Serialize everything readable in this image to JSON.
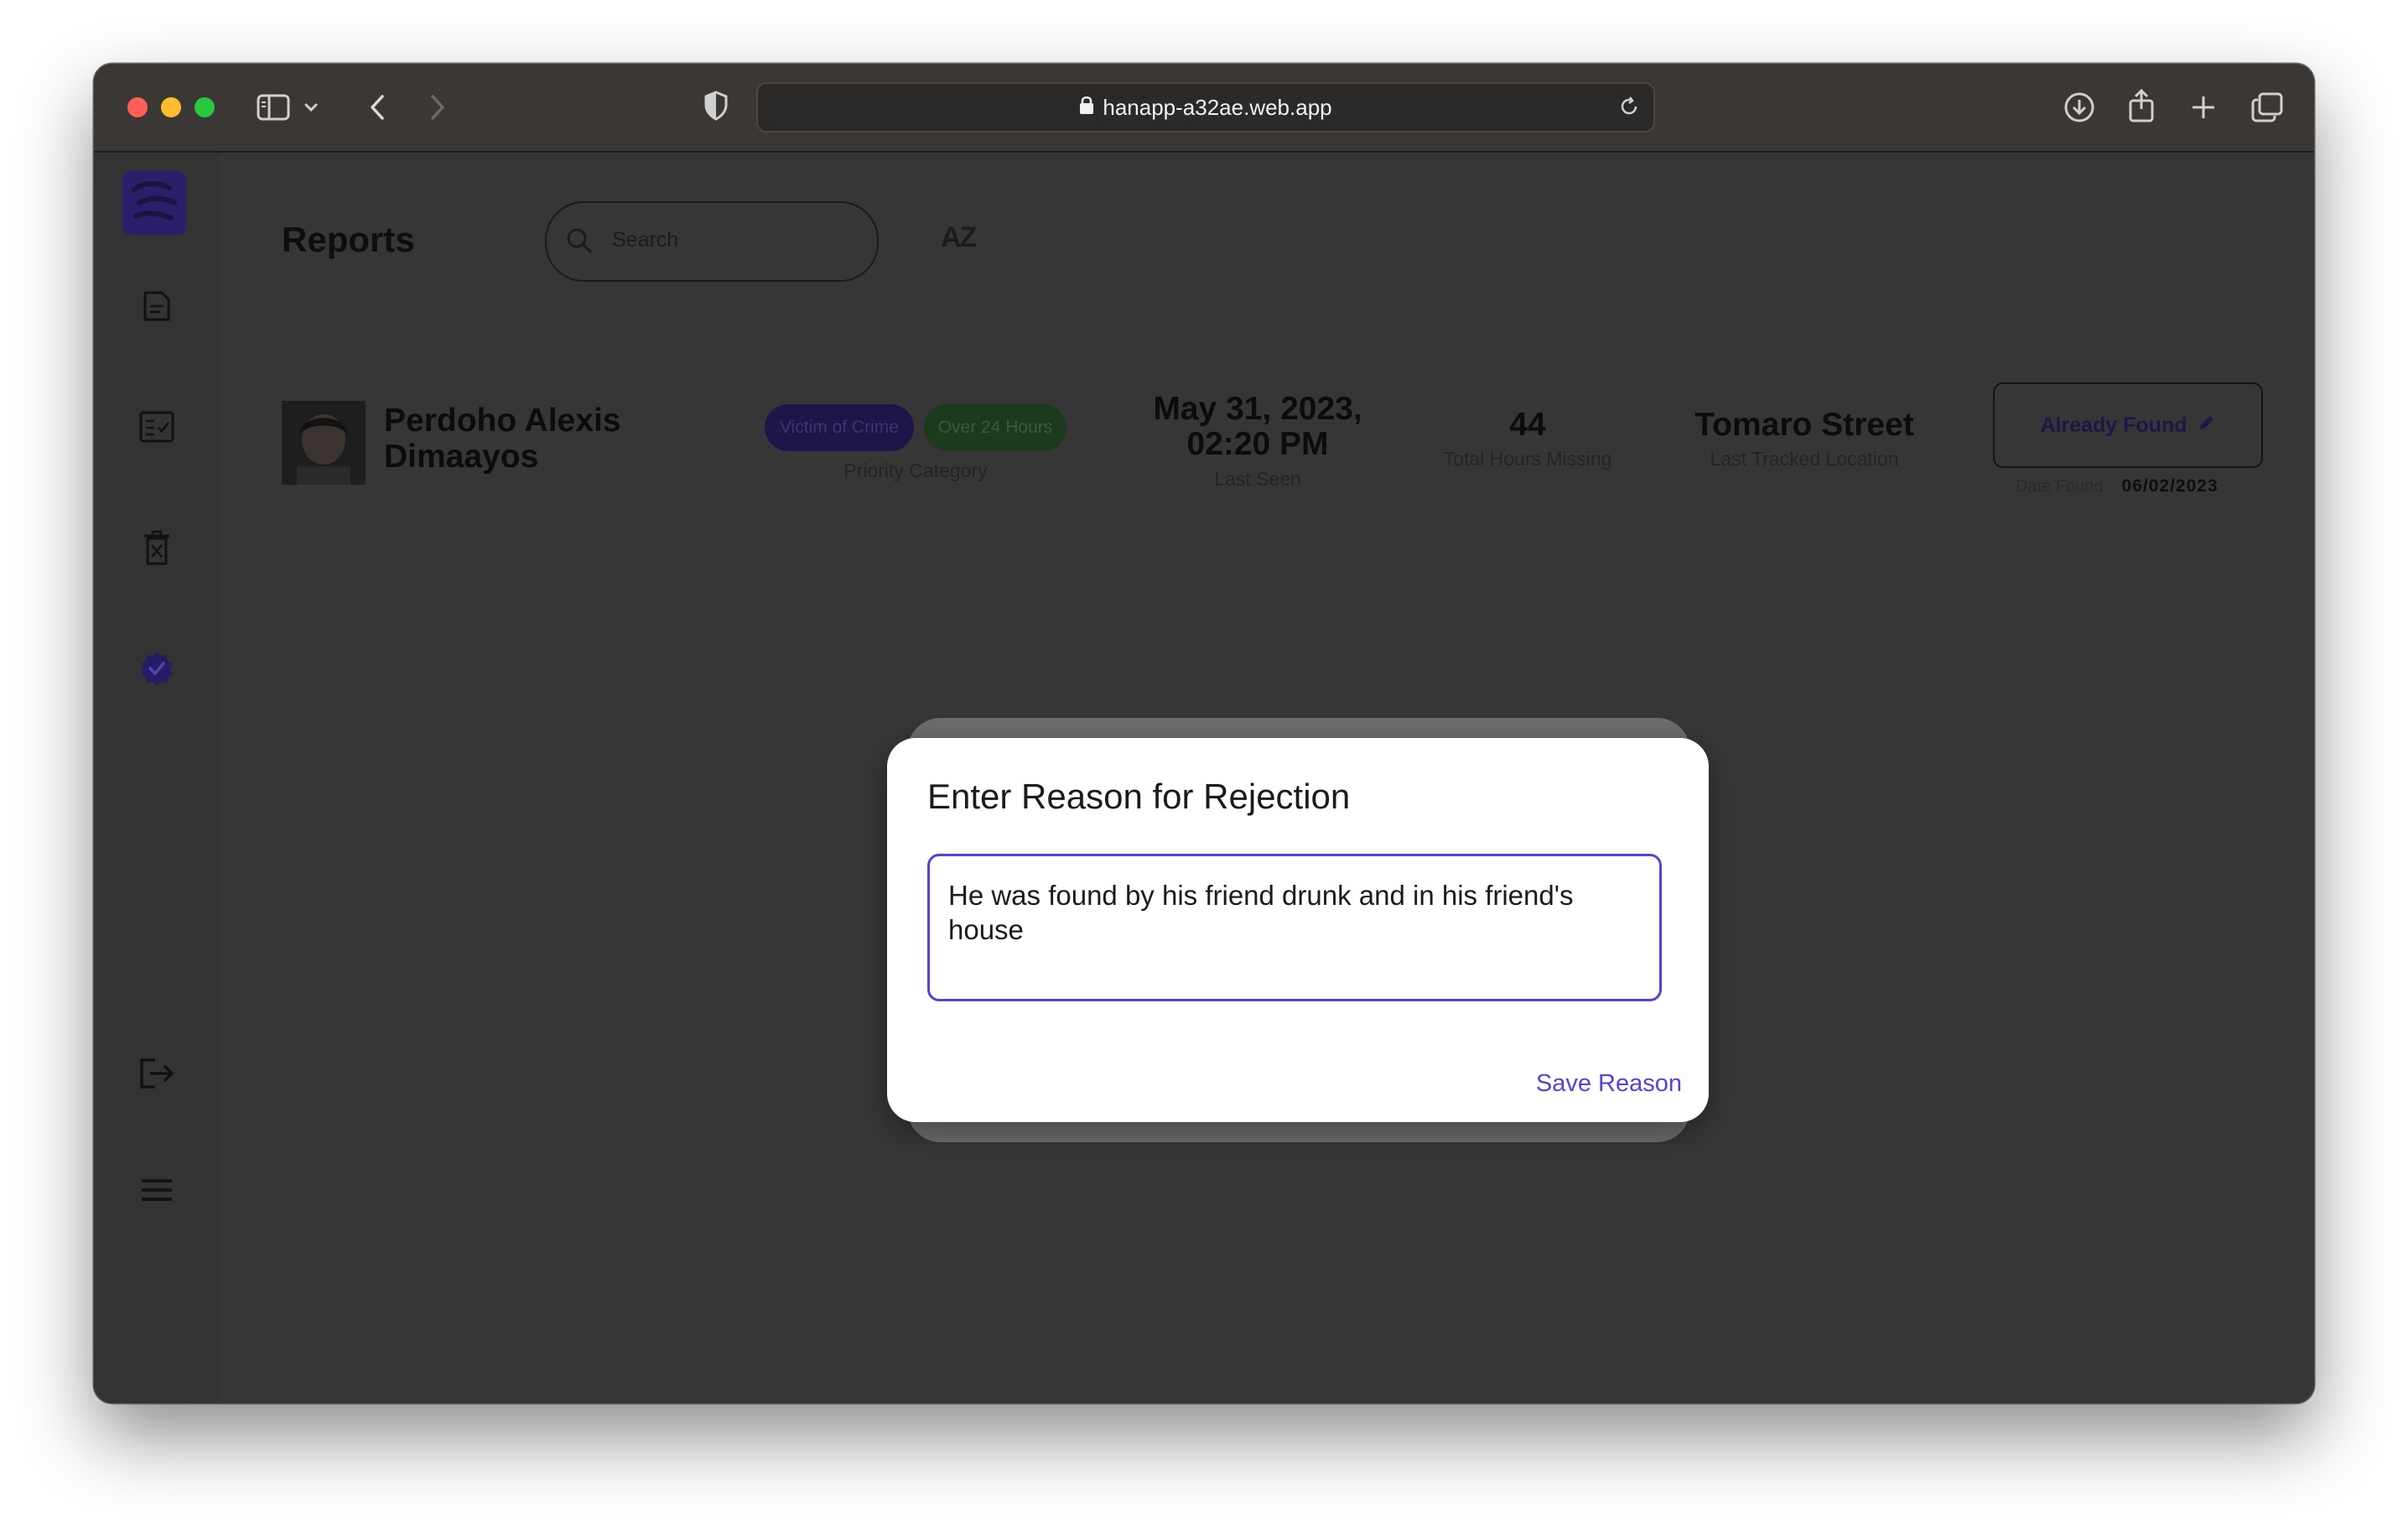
{
  "browser": {
    "url": "hanapp-a32ae.web.app",
    "traffic_lights": [
      "#fe5f57",
      "#febc2e",
      "#28c840"
    ]
  },
  "sidebar": {
    "items": [
      {
        "icon": "reports-document-icon"
      },
      {
        "icon": "checklist-icon"
      },
      {
        "icon": "trash-icon"
      },
      {
        "icon": "verified-badge-icon"
      },
      {
        "icon": "logout-icon"
      },
      {
        "icon": "menu-icon"
      }
    ]
  },
  "page": {
    "title": "Reports",
    "search_placeholder": "Search",
    "sort_label": "AZ"
  },
  "report": {
    "name": "Perdoho Alexis Dimaayos",
    "tags": [
      "Victim of Crime",
      "Over 24 Hours"
    ],
    "priority_label": "Priority Category",
    "last_seen_value": "May 31, 2023, 02:20 PM",
    "last_seen_label": "Last Seen",
    "hours_value": "44",
    "hours_label": "Total Hours Missing",
    "location_value": "Tomaro Street",
    "location_label": "Last Tracked Location",
    "status_button": "Already Found",
    "date_found_label": "Date Found",
    "date_found_value": "06/02/2023"
  },
  "dialog": {
    "title": "Enter Reason for Rejection",
    "reason_value": "He was found by his friend drunk and in his friend's house",
    "save_label": "Save Reason"
  },
  "colors": {
    "accent": "#5b3fd6",
    "brand_dark": "#2a1f6b"
  }
}
